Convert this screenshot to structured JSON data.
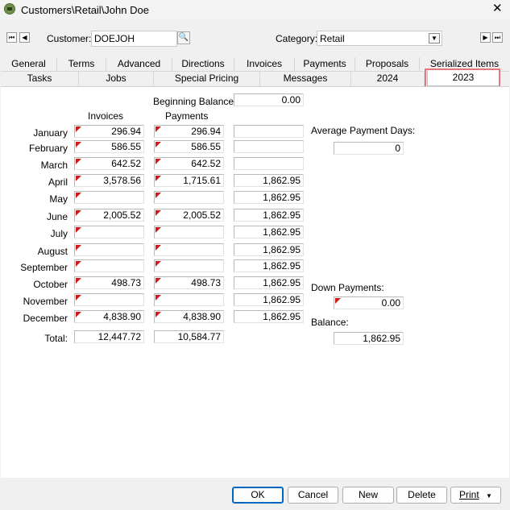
{
  "window": {
    "title": "Customers\\Retail\\John Doe"
  },
  "header": {
    "customer_label": "Customer:",
    "customer_value": "DOEJOH",
    "category_label": "Category:",
    "category_value": "Retail"
  },
  "tabs_row1": [
    "General",
    "Terms",
    "Advanced",
    "Directions",
    "Invoices",
    "Payments",
    "Proposals",
    "Serialized Items"
  ],
  "tabs_row2": [
    "Tasks",
    "Jobs",
    "Special Pricing",
    "Messages",
    "2024",
    "2023"
  ],
  "year": {
    "beginning_balance_label": "Beginning Balance:",
    "beginning_balance": "0.00",
    "invoices_header": "Invoices",
    "payments_header": "Payments",
    "months": [
      {
        "name": "January",
        "invoice": "296.94",
        "payment": "296.94",
        "balance": ""
      },
      {
        "name": "February",
        "invoice": "586.55",
        "payment": "586.55",
        "balance": ""
      },
      {
        "name": "March",
        "invoice": "642.52",
        "payment": "642.52",
        "balance": ""
      },
      {
        "name": "April",
        "invoice": "3,578.56",
        "payment": "1,715.61",
        "balance": "1,862.95"
      },
      {
        "name": "May",
        "invoice": "",
        "payment": "",
        "balance": "1,862.95"
      },
      {
        "name": "June",
        "invoice": "2,005.52",
        "payment": "2,005.52",
        "balance": "1,862.95"
      },
      {
        "name": "July",
        "invoice": "",
        "payment": "",
        "balance": "1,862.95"
      },
      {
        "name": "August",
        "invoice": "",
        "payment": "",
        "balance": "1,862.95"
      },
      {
        "name": "September",
        "invoice": "",
        "payment": "",
        "balance": "1,862.95"
      },
      {
        "name": "October",
        "invoice": "498.73",
        "payment": "498.73",
        "balance": "1,862.95"
      },
      {
        "name": "November",
        "invoice": "",
        "payment": "",
        "balance": "1,862.95"
      },
      {
        "name": "December",
        "invoice": "4,838.90",
        "payment": "4,838.90",
        "balance": "1,862.95"
      }
    ],
    "total_label": "Total:",
    "total_invoices": "12,447.72",
    "total_payments": "10,584.77",
    "avg_days_label": "Average Payment Days:",
    "avg_days": "0",
    "down_payments_label": "Down Payments:",
    "down_payments": "0.00",
    "balance_label": "Balance:",
    "balance": "1,862.95"
  },
  "buttons": {
    "ok": "OK",
    "cancel": "Cancel",
    "new": "New",
    "delete": "Delete",
    "print": "Print"
  },
  "colors": {
    "highlight_outline": "#e4777b",
    "flag_red": "#d21a1a",
    "primary_border": "#0067c0"
  }
}
